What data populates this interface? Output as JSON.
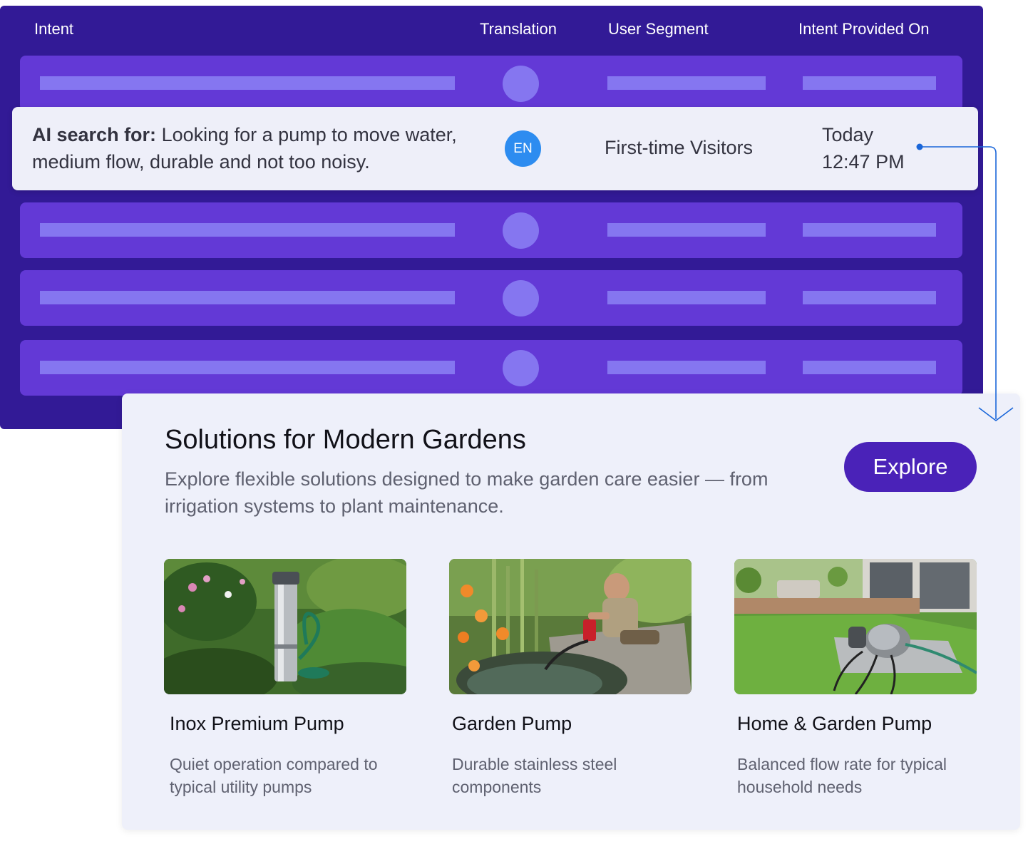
{
  "table": {
    "headers": [
      "Intent",
      "Translation",
      "User Segment",
      "Intent Provided On"
    ],
    "selected_row": {
      "intent_prefix": "AI search for:",
      "intent_text": "Looking for a pump to move water, medium flow, durable and not too noisy.",
      "language": "EN",
      "segment": "First-time Visitors",
      "date_day": "Today",
      "date_time": "12:47 PM"
    }
  },
  "solutions": {
    "title": "Solutions for Modern Gardens",
    "description": "Explore flexible solutions designed to make garden care easier — from irrigation systems to plant maintenance.",
    "cta_label": "Explore",
    "products": [
      {
        "name": "Inox Premium Pump",
        "description": "Quiet operation compared to typical utility pumps"
      },
      {
        "name": "Garden Pump",
        "description": "Durable stainless steel components"
      },
      {
        "name": "Home & Garden Pump",
        "description": "Balanced flow rate for typical household needs"
      }
    ]
  },
  "colors": {
    "table_bg": "#321a96",
    "row_placeholder": "#6339d6",
    "bar_placeholder": "#8576f0",
    "badge": "#2d8cf0",
    "button": "#4a22b8",
    "connector": "#1a66d9"
  }
}
